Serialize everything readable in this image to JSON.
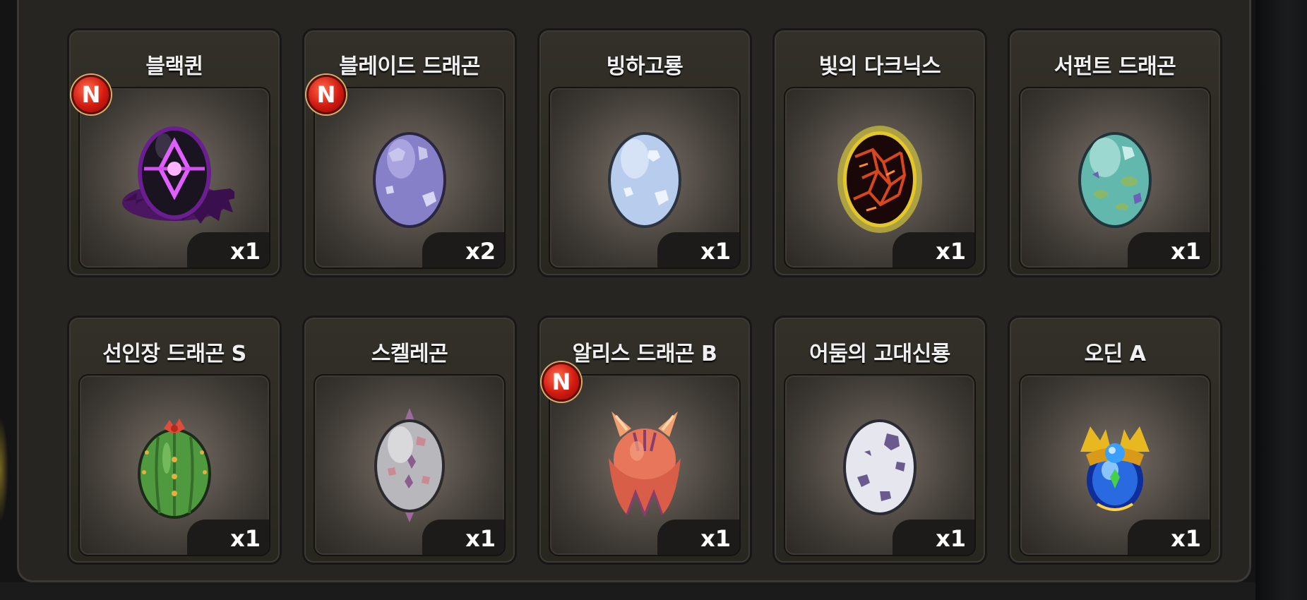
{
  "items": [
    {
      "name": "블랙퀸",
      "qty": "x1",
      "badge": "N",
      "egg": "black-queen-egg"
    },
    {
      "name": "블레이드 드래곤",
      "qty": "x2",
      "badge": "N",
      "egg": "blade-dragon-egg"
    },
    {
      "name": "빙하고룡",
      "qty": "x1",
      "badge": "",
      "egg": "glacier-dragon-egg"
    },
    {
      "name": "빛의 다크닉스",
      "qty": "x1",
      "badge": "",
      "egg": "darknyx-egg"
    },
    {
      "name": "서펀트 드래곤",
      "qty": "x1",
      "badge": "",
      "egg": "serpent-dragon-egg"
    },
    {
      "name": "선인장 드래곤 S",
      "qty": "x1",
      "badge": "",
      "egg": "cactus-dragon-egg"
    },
    {
      "name": "스켈레곤",
      "qty": "x1",
      "badge": "",
      "egg": "skelegon-egg"
    },
    {
      "name": "알리스 드래곤 B",
      "qty": "x1",
      "badge": "N",
      "egg": "alice-dragon-egg"
    },
    {
      "name": "어둠의 고대신룡",
      "qty": "x1",
      "badge": "",
      "egg": "ancient-dark-dragon-egg"
    },
    {
      "name": "오딘 A",
      "qty": "x1",
      "badge": "",
      "egg": "odin-egg"
    }
  ],
  "colors": {
    "panel": "#262522",
    "badge_red": "#d11a10",
    "text": "#f0f0f0"
  }
}
